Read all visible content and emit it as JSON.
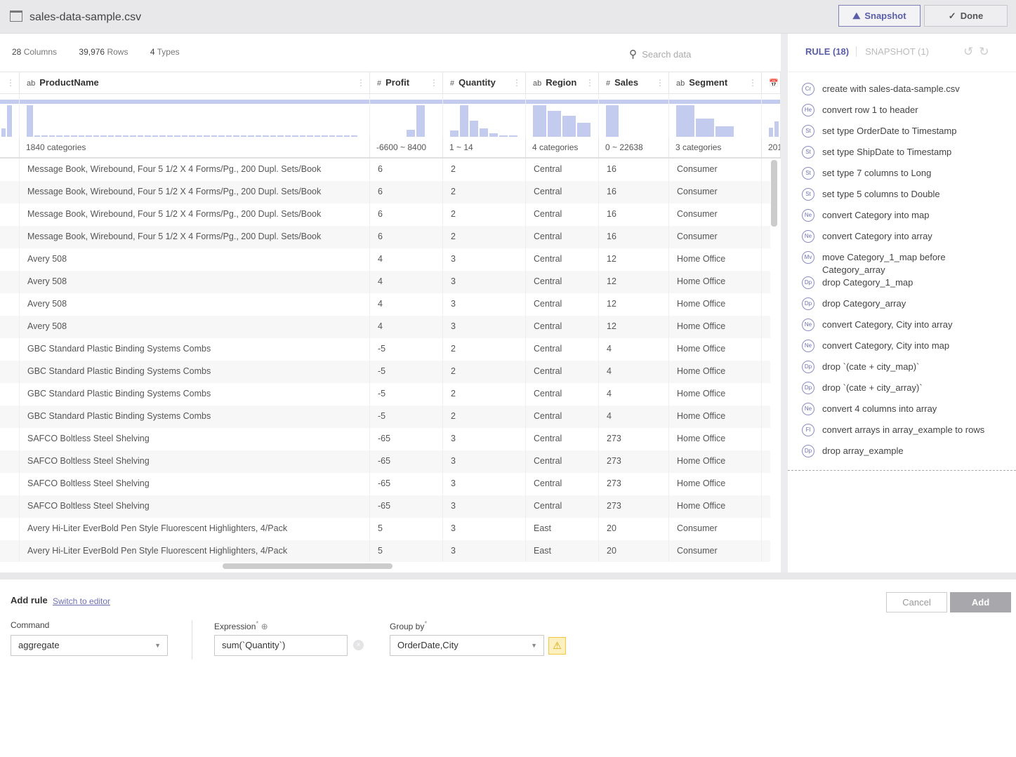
{
  "header": {
    "title": "sales-data-sample.csv",
    "snapshot_label": "Snapshot",
    "done_label": "Done"
  },
  "stats": {
    "columns": "28",
    "columns_label": "Columns",
    "rows": "39,976",
    "rows_label": "Rows",
    "types": "4",
    "types_label": "Types"
  },
  "search": {
    "placeholder": "Search data"
  },
  "columns": [
    {
      "type": "ab",
      "name": "ProductName",
      "summary": "1840 categories",
      "hist": [
        1,
        0.04,
        0.03,
        0.03,
        0.03,
        0.03,
        0.03,
        0.03,
        0.03,
        0.03,
        0.03,
        0.03,
        0.03,
        0.03,
        0.03,
        0.03,
        0.03,
        0.03,
        0.03,
        0.03,
        0.03,
        0.03,
        0.03,
        0.03,
        0.03,
        0.03,
        0.03,
        0.03,
        0.03,
        0.03,
        0.03,
        0.03,
        0.03,
        0.03,
        0.03,
        0.03,
        0.03,
        0.03,
        0.03,
        0.03,
        0.03,
        0.03,
        0.03,
        0.03,
        0.03
      ]
    },
    {
      "type": "#",
      "name": "Profit",
      "summary": "-6600 ~ 8400",
      "hist": [
        0,
        0,
        0,
        0.22,
        1,
        0
      ]
    },
    {
      "type": "#",
      "name": "Quantity",
      "summary": "1 ~ 14",
      "hist": [
        0.2,
        1,
        0.52,
        0.26,
        0.12,
        0.02,
        0.02
      ]
    },
    {
      "type": "ab",
      "name": "Region",
      "summary": "4 categories",
      "hist": [
        1,
        0.83,
        0.67,
        0.45
      ]
    },
    {
      "type": "#",
      "name": "Sales",
      "summary": "0 ~ 22638",
      "hist": [
        1,
        0,
        0,
        0
      ]
    },
    {
      "type": "ab",
      "name": "Segment",
      "summary": "3 categories",
      "hist": [
        1,
        0.57,
        0.33
      ]
    },
    {
      "type": "date",
      "name": "",
      "summary": "201",
      "hist": [
        0.3,
        0.5
      ]
    }
  ],
  "rows": [
    [
      "Message Book, Wirebound, Four 5 1/2 X 4 Forms/Pg., 200 Dupl. Sets/Book",
      "6",
      "2",
      "Central",
      "16",
      "Consumer"
    ],
    [
      "Message Book, Wirebound, Four 5 1/2 X 4 Forms/Pg., 200 Dupl. Sets/Book",
      "6",
      "2",
      "Central",
      "16",
      "Consumer"
    ],
    [
      "Message Book, Wirebound, Four 5 1/2 X 4 Forms/Pg., 200 Dupl. Sets/Book",
      "6",
      "2",
      "Central",
      "16",
      "Consumer"
    ],
    [
      "Message Book, Wirebound, Four 5 1/2 X 4 Forms/Pg., 200 Dupl. Sets/Book",
      "6",
      "2",
      "Central",
      "16",
      "Consumer"
    ],
    [
      "Avery 508",
      "4",
      "3",
      "Central",
      "12",
      "Home Office"
    ],
    [
      "Avery 508",
      "4",
      "3",
      "Central",
      "12",
      "Home Office"
    ],
    [
      "Avery 508",
      "4",
      "3",
      "Central",
      "12",
      "Home Office"
    ],
    [
      "Avery 508",
      "4",
      "3",
      "Central",
      "12",
      "Home Office"
    ],
    [
      "GBC Standard Plastic Binding Systems Combs",
      "-5",
      "2",
      "Central",
      "4",
      "Home Office"
    ],
    [
      "GBC Standard Plastic Binding Systems Combs",
      "-5",
      "2",
      "Central",
      "4",
      "Home Office"
    ],
    [
      "GBC Standard Plastic Binding Systems Combs",
      "-5",
      "2",
      "Central",
      "4",
      "Home Office"
    ],
    [
      "GBC Standard Plastic Binding Systems Combs",
      "-5",
      "2",
      "Central",
      "4",
      "Home Office"
    ],
    [
      "SAFCO Boltless Steel Shelving",
      "-65",
      "3",
      "Central",
      "273",
      "Home Office"
    ],
    [
      "SAFCO Boltless Steel Shelving",
      "-65",
      "3",
      "Central",
      "273",
      "Home Office"
    ],
    [
      "SAFCO Boltless Steel Shelving",
      "-65",
      "3",
      "Central",
      "273",
      "Home Office"
    ],
    [
      "SAFCO Boltless Steel Shelving",
      "-65",
      "3",
      "Central",
      "273",
      "Home Office"
    ],
    [
      "Avery Hi-Liter EverBold Pen Style Fluorescent Highlighters, 4/Pack",
      "5",
      "3",
      "East",
      "20",
      "Consumer"
    ],
    [
      "Avery Hi-Liter EverBold Pen Style Fluorescent Highlighters, 4/Pack",
      "5",
      "3",
      "East",
      "20",
      "Consumer"
    ]
  ],
  "rules_panel": {
    "rule_tab": "RULE (18)",
    "snapshot_tab": "SNAPSHOT (1)"
  },
  "rules": [
    {
      "code": "Cr",
      "text": "create with sales-data-sample.csv"
    },
    {
      "code": "He",
      "text": "convert row 1 to header"
    },
    {
      "code": "St",
      "text": "set type OrderDate to Timestamp"
    },
    {
      "code": "St",
      "text": "set type ShipDate to Timestamp"
    },
    {
      "code": "St",
      "text": "set type 7 columns to Long"
    },
    {
      "code": "St",
      "text": "set type 5 columns to Double"
    },
    {
      "code": "Ne",
      "text": "convert Category into map"
    },
    {
      "code": "Ne",
      "text": "convert Category into array"
    },
    {
      "code": "Mv",
      "text": "move Category_1_map before Category_array"
    },
    {
      "code": "Dp",
      "text": "drop Category_1_map"
    },
    {
      "code": "Dp",
      "text": "drop Category_array"
    },
    {
      "code": "Ne",
      "text": "convert Category, City into array"
    },
    {
      "code": "Ne",
      "text": "convert Category, City into map"
    },
    {
      "code": "Dp",
      "text": "drop `(cate + city_map)`"
    },
    {
      "code": "Dp",
      "text": "drop `(cate + city_array)`"
    },
    {
      "code": "Ne",
      "text": "convert 4 columns into array"
    },
    {
      "code": "Fl",
      "text": "convert arrays in array_example to rows"
    },
    {
      "code": "Dp",
      "text": "drop array_example"
    }
  ],
  "add_rule": {
    "title": "Add rule",
    "switch_label": "Switch to editor",
    "command_label": "Command",
    "command_value": "aggregate",
    "expression_label": "Expression",
    "expression_value": "sum(`Quantity`)",
    "groupby_label": "Group by",
    "groupby_value": "OrderDate,City",
    "required_mark": "*",
    "cancel_label": "Cancel",
    "add_label": "Add"
  },
  "colors": {
    "accent": "#5a5ea8",
    "histogram": "#c3ccef",
    "warning": "#f5c842"
  }
}
